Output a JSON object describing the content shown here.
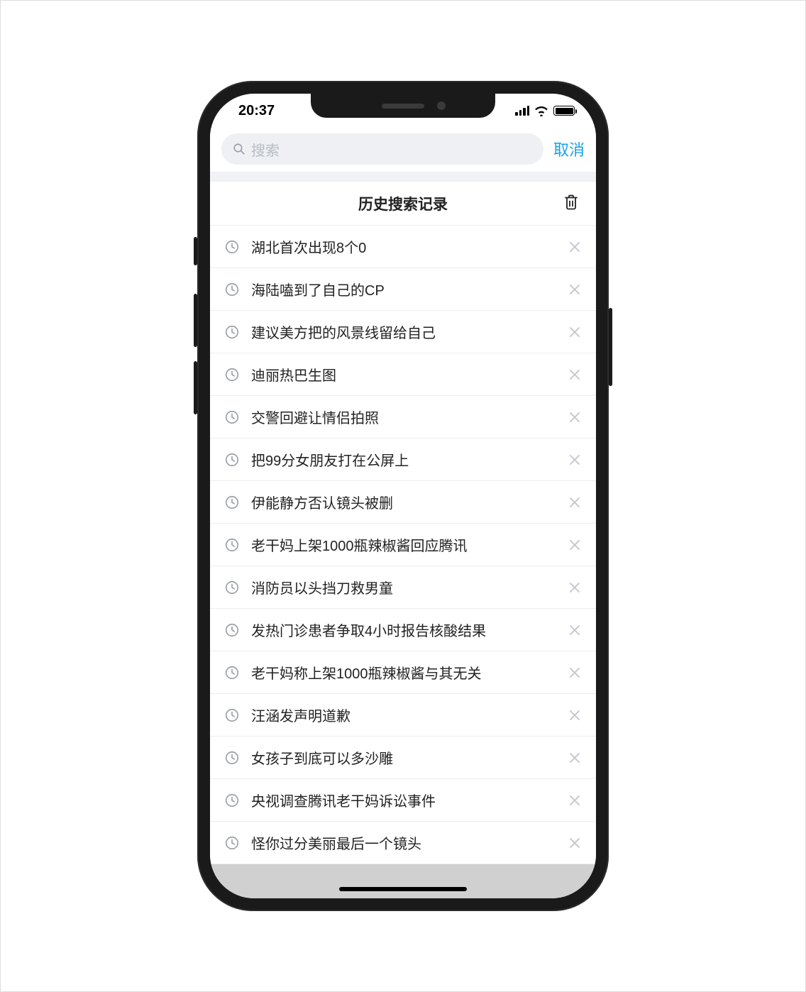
{
  "status": {
    "time": "20:37"
  },
  "search": {
    "placeholder": "搜索",
    "cancel": "取消"
  },
  "section": {
    "title": "历史搜索记录"
  },
  "history": {
    "items": [
      "湖北首次出现8个0",
      "海陆嗑到了自己的CP",
      "建议美方把的风景线留给自己",
      "迪丽热巴生图",
      "交警回避让情侣拍照",
      "把99分女朋友打在公屏上",
      "伊能静方否认镜头被删",
      "老干妈上架1000瓶辣椒酱回应腾讯",
      "消防员以头挡刀救男童",
      "发热门诊患者争取4小时报告核酸结果",
      "老干妈称上架1000瓶辣椒酱与其无关",
      "汪涵发声明道歉",
      "女孩子到底可以多沙雕",
      "央视调查腾讯老干妈诉讼事件",
      "怪你过分美丽最后一个镜头"
    ]
  }
}
